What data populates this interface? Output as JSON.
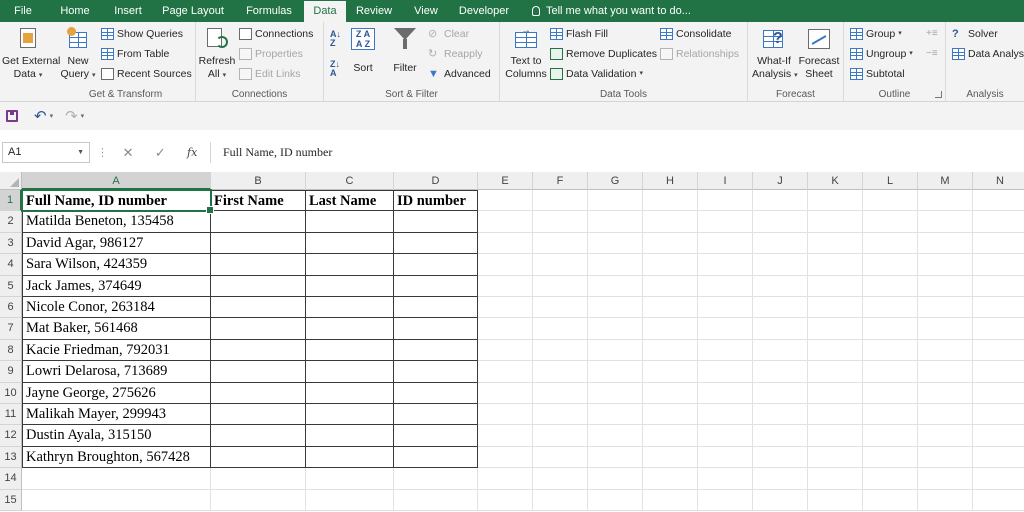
{
  "tabs": [
    "File",
    "Home",
    "Insert",
    "Page Layout",
    "Formulas",
    "Data",
    "Review",
    "View",
    "Developer"
  ],
  "active_tab": "Data",
  "tell_me": "Tell me what you want to do...",
  "ribbon": {
    "get_external": {
      "line1": "Get External",
      "line2": "Data"
    },
    "get_transform": {
      "label": "Get & Transform",
      "new_query": {
        "line1": "New",
        "line2": "Query"
      },
      "show_queries": "Show Queries",
      "from_table": "From Table",
      "recent_sources": "Recent Sources"
    },
    "connections": {
      "label": "Connections",
      "refresh": {
        "line1": "Refresh",
        "line2": "All"
      },
      "connections": "Connections",
      "properties": "Properties",
      "edit_links": "Edit Links"
    },
    "sort_filter": {
      "label": "Sort & Filter",
      "sort": "Sort",
      "filter": "Filter",
      "clear": "Clear",
      "reapply": "Reapply",
      "advanced": "Advanced"
    },
    "data_tools": {
      "label": "Data Tools",
      "text_to_columns": {
        "line1": "Text to",
        "line2": "Columns"
      },
      "flash_fill": "Flash Fill",
      "remove_duplicates": "Remove Duplicates",
      "data_validation": "Data Validation",
      "consolidate": "Consolidate",
      "relationships": "Relationships"
    },
    "forecast": {
      "label": "Forecast",
      "what_if": {
        "line1": "What-If",
        "line2": "Analysis"
      },
      "forecast_sheet": {
        "line1": "Forecast",
        "line2": "Sheet"
      }
    },
    "outline": {
      "label": "Outline",
      "group": "Group",
      "ungroup": "Ungroup",
      "subtotal": "Subtotal"
    },
    "analysis": {
      "label": "Analysis",
      "solver": "Solver",
      "data_analysis": "Data Analysis"
    }
  },
  "formula_bar": {
    "name_box": "A1",
    "content": "Full Name, ID number",
    "fx": "fx"
  },
  "columns": [
    "A",
    "B",
    "C",
    "D",
    "E",
    "F",
    "G",
    "H",
    "I",
    "J",
    "K",
    "L",
    "M",
    "N"
  ],
  "rows": [
    "1",
    "2",
    "3",
    "4",
    "5",
    "6",
    "7",
    "8",
    "9",
    "10",
    "11",
    "12",
    "13",
    "14",
    "15"
  ],
  "sheet": {
    "headers": [
      "Full Name, ID number",
      "First Name",
      "Last Name",
      "ID number"
    ],
    "entries": [
      "Matilda Beneton, 135458",
      "David Agar, 986127",
      "Sara Wilson, 424359",
      "Jack James, 374649",
      "Nicole Conor, 263184",
      "Mat Baker, 561468",
      "Kacie Friedman, 792031",
      "Lowri Delarosa, 713689",
      "Jayne George, 275626",
      "Malikah Mayer, 299943",
      "Dustin Ayala, 315150",
      "Kathryn Broughton, 567428"
    ]
  },
  "colors": {
    "accent": "#217346",
    "ribbon_bg": "#f3f3f3"
  }
}
